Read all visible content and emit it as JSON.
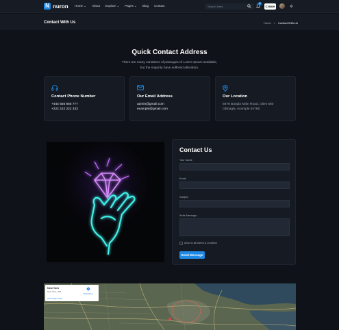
{
  "brand": {
    "logo_letter": "N",
    "name": "nuron",
    "accent": "#1e88e5"
  },
  "nav": {
    "items": [
      {
        "label": "Home",
        "has_dropdown": true
      },
      {
        "label": "About",
        "has_dropdown": false
      },
      {
        "label": "Explore",
        "has_dropdown": true
      },
      {
        "label": "Pages",
        "has_dropdown": true
      },
      {
        "label": "Blog",
        "has_dropdown": false
      },
      {
        "label": "Contact",
        "has_dropdown": false
      }
    ],
    "search_placeholder": "Search Here",
    "notification_count": "6",
    "create_label": "Create"
  },
  "breadcrumb": {
    "page_title": "Contact With Us",
    "home": "Home",
    "separator": ">",
    "current": "Contact With Us"
  },
  "quick_contact": {
    "title": "Quick Contact Address",
    "description_line1": "There are many variations of passages of Lorem Ipsum available,",
    "description_line2": "but the majority have suffered alteration.",
    "cards": [
      {
        "icon": "headphones-icon",
        "title": "Contact Phone Number",
        "line1": "+444 555 666 777",
        "line2": "+222 222 222 333"
      },
      {
        "icon": "mail-icon",
        "title": "Our Email Address",
        "line1": "admin@gmail.com",
        "line2": "example@gmail.com"
      },
      {
        "icon": "location-pin-icon",
        "title": "Our Location",
        "line1": "5678 Bangla Main Road, cities 580",
        "line2": "GBnagla, example 54786"
      }
    ]
  },
  "contact_form": {
    "title": "Contact Us",
    "name_label": "Your Name",
    "email_label": "Email",
    "subject_label": "Subject",
    "message_label": "Write Message",
    "terms_label": "Allow to all tearms & condition",
    "submit_label": "Send Message"
  },
  "map": {
    "place_title": "New York",
    "place_subtitle": "New York, USA",
    "directions_label": "Directions",
    "larger_map_link": "View larger map"
  }
}
